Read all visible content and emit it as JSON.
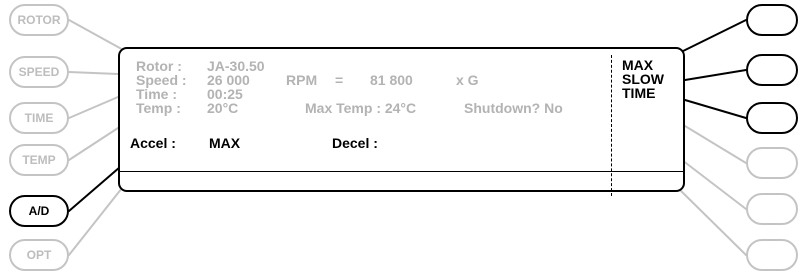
{
  "left_buttons": [
    {
      "label": "ROTOR",
      "active": false
    },
    {
      "label": "SPEED",
      "active": false
    },
    {
      "label": "TIME",
      "active": false
    },
    {
      "label": "TEMP",
      "active": false
    },
    {
      "label": "A/D",
      "active": true
    },
    {
      "label": "OPT",
      "active": false
    }
  ],
  "display": {
    "rotor_label": "Rotor :",
    "rotor_value": "JA-30.50",
    "speed_label": "Speed :",
    "speed_value": "26 000",
    "rpm_label": "RPM",
    "equals": "=",
    "g_value": "81 800",
    "g_unit": "x G",
    "time_label": "Time :",
    "time_value": "00:25",
    "temp_label": "Temp :",
    "temp_value": "20°C",
    "max_temp": "Max Temp : 24°C",
    "shutdown": "Shutdown? No",
    "accel_label": "Accel :",
    "accel_value": "MAX",
    "decel_label": "Decel :",
    "softkeys": [
      "MAX",
      "SLOW",
      "TIME"
    ]
  },
  "colors": {
    "active": "#000000",
    "inactive": "#c4c4c4",
    "dim_text": "#b3b3b3"
  }
}
